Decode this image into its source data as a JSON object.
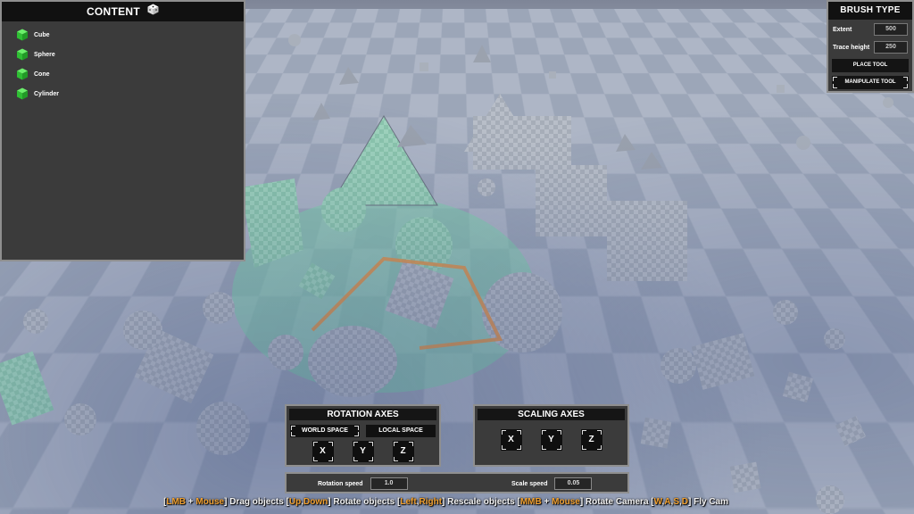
{
  "content_panel": {
    "title": "CONTENT",
    "items": [
      {
        "label": "Cube",
        "icon": "green-cube-icon"
      },
      {
        "label": "Sphere",
        "icon": "green-cube-icon"
      },
      {
        "label": "Cone",
        "icon": "green-cube-icon"
      },
      {
        "label": "Cylinder",
        "icon": "green-cube-icon"
      }
    ]
  },
  "brush_panel": {
    "title": "BRUSH TYPE",
    "extent_label": "Extent",
    "extent_value": "500",
    "trace_height_label": "Trace height",
    "trace_height_value": "250",
    "place_tool": "PLACE TOOL",
    "manipulate_tool": "MANIPULATE TOOL"
  },
  "rotation_panel": {
    "title": "ROTATION AXES",
    "world_space": "WORLD SPACE",
    "local_space": "LOCAL SPACE",
    "axes": [
      "X",
      "Y",
      "Z"
    ]
  },
  "scaling_panel": {
    "title": "SCALING AXES",
    "axes": [
      "X",
      "Y",
      "Z"
    ]
  },
  "speed_panel": {
    "rotation_label": "Rotation speed",
    "rotation_value": "1.0",
    "scale_label": "Scale speed",
    "scale_value": "0.05"
  },
  "hint": {
    "b1": "[",
    "k1": "LMB",
    "t1": " + ",
    "k2": "Mouse",
    "t2": "] Drag objects [",
    "k3": "Up",
    "t3": ",",
    "k4": "Down",
    "t4": "] Rotate objects [",
    "k5": "Left",
    "t5": ",",
    "k6": "Right",
    "t6": "] Rescale objects [",
    "k7": "MMB",
    "t7": " + ",
    "k8": "Mouse",
    "t8": "] Rotate Camera [",
    "k9": "W",
    "t9": ",",
    "k10": "A",
    "t10": ",",
    "k11": "S",
    "t11": ",",
    "k12": "D",
    "t12": "] Fly Cam"
  },
  "colors": {
    "accent_key": "#f0a030",
    "panel_bg": "#3b3b3b",
    "header_bg": "#111111",
    "content_icon": "#36d13e"
  }
}
